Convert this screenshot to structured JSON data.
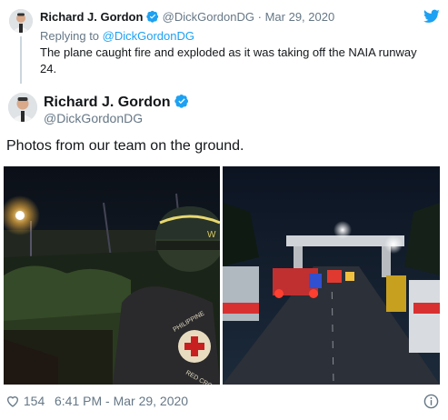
{
  "reply_tweet": {
    "name": "Richard J. Gordon",
    "handle": "@DickGordonDG",
    "separator": "·",
    "date": "Mar 29, 2020",
    "replying_prefix": "Replying to ",
    "replying_handle": "@DickGordonDG",
    "text": "The plane caught fire and exploded as it was taking off the NAIA runway 24."
  },
  "main_tweet": {
    "name": "Richard J. Gordon",
    "handle": "@DickGordonDG",
    "text": "Photos from our team on the ground.",
    "likes": "154",
    "timestamp": "6:41 PM - Mar 29, 2020"
  },
  "icons": {
    "verified": "verified-badge-icon",
    "twitter": "twitter-bird-icon",
    "heart": "heart-icon",
    "info": "info-icon"
  },
  "colors": {
    "accent": "#1da1f2",
    "text": "#14171a",
    "muted": "#657786"
  }
}
